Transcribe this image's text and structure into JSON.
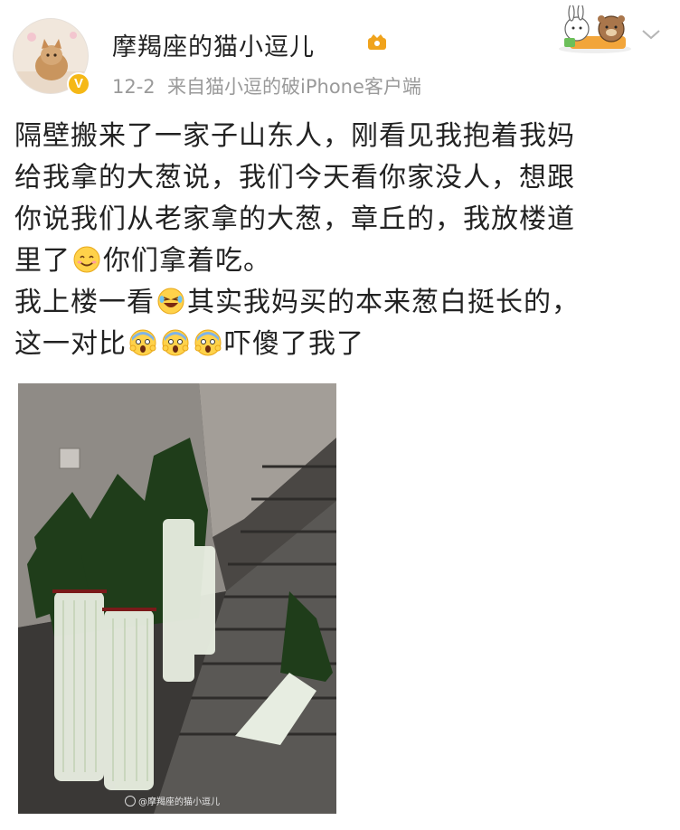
{
  "post": {
    "username": "摩羯座的猫小逗儿",
    "date": "12-2",
    "source_prefix": "来自",
    "source": "猫小逗的破iPhone客户端",
    "lines": [
      "隔壁搬来了一家子山东人，刚看见我抱着我妈",
      "给我拿的大葱说，我们今天看你家没人，想跟",
      "你说我们从老家拿的大葱，章丘的，我放楼道",
      "里了",
      "你们拿着吃。",
      "我上楼一看",
      "其实我妈买的本来葱白挺长的，",
      "这一对比",
      "吓傻了我了"
    ]
  },
  "photo": {
    "watermark": "@摩羯座的猫小逗儿"
  },
  "colors": {
    "text": "#222222",
    "meta": "#9a9a9a",
    "badge": "#f5b816"
  }
}
